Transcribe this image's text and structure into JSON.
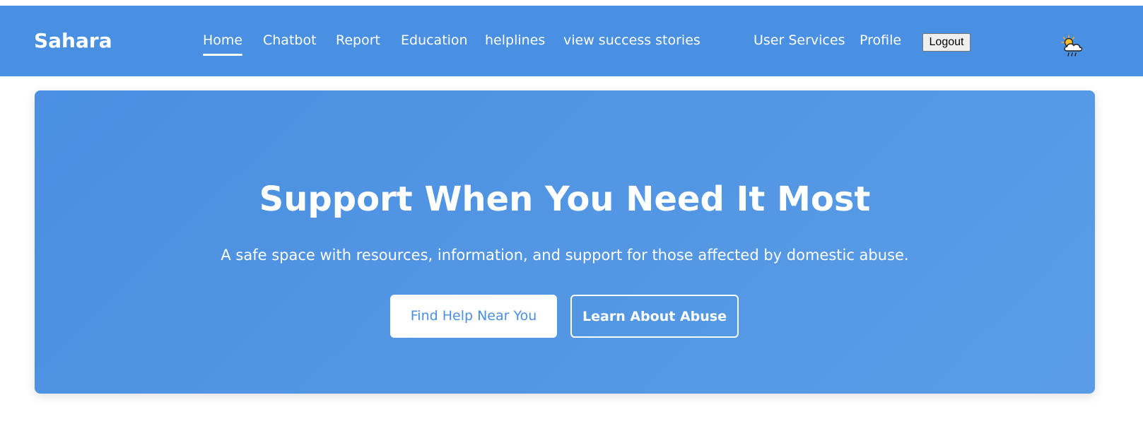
{
  "navbar": {
    "brand": "Sahara",
    "links": [
      {
        "label": "Home",
        "active": true
      },
      {
        "label": "Chatbot"
      },
      {
        "label": "Report"
      },
      {
        "label": "Education"
      },
      {
        "label": "helplines"
      },
      {
        "label": "view success stories"
      },
      {
        "label": "User Services"
      },
      {
        "label": "Profile"
      }
    ],
    "logout_label": "Logout",
    "weather_icon": "cloud-sun-rain-icon"
  },
  "hero": {
    "title": "Support When You Need It Most",
    "subtitle": "A safe space with resources, information, and support for those affected by domestic abuse.",
    "primary_button": "Find Help Near You",
    "secondary_button": "Learn About Abuse"
  },
  "colors": {
    "brand_blue": "#4a90e2",
    "hero_gradient_start": "#4a8fe1",
    "hero_gradient_end": "#5a9de6",
    "text_on_blue": "#ffffff"
  }
}
